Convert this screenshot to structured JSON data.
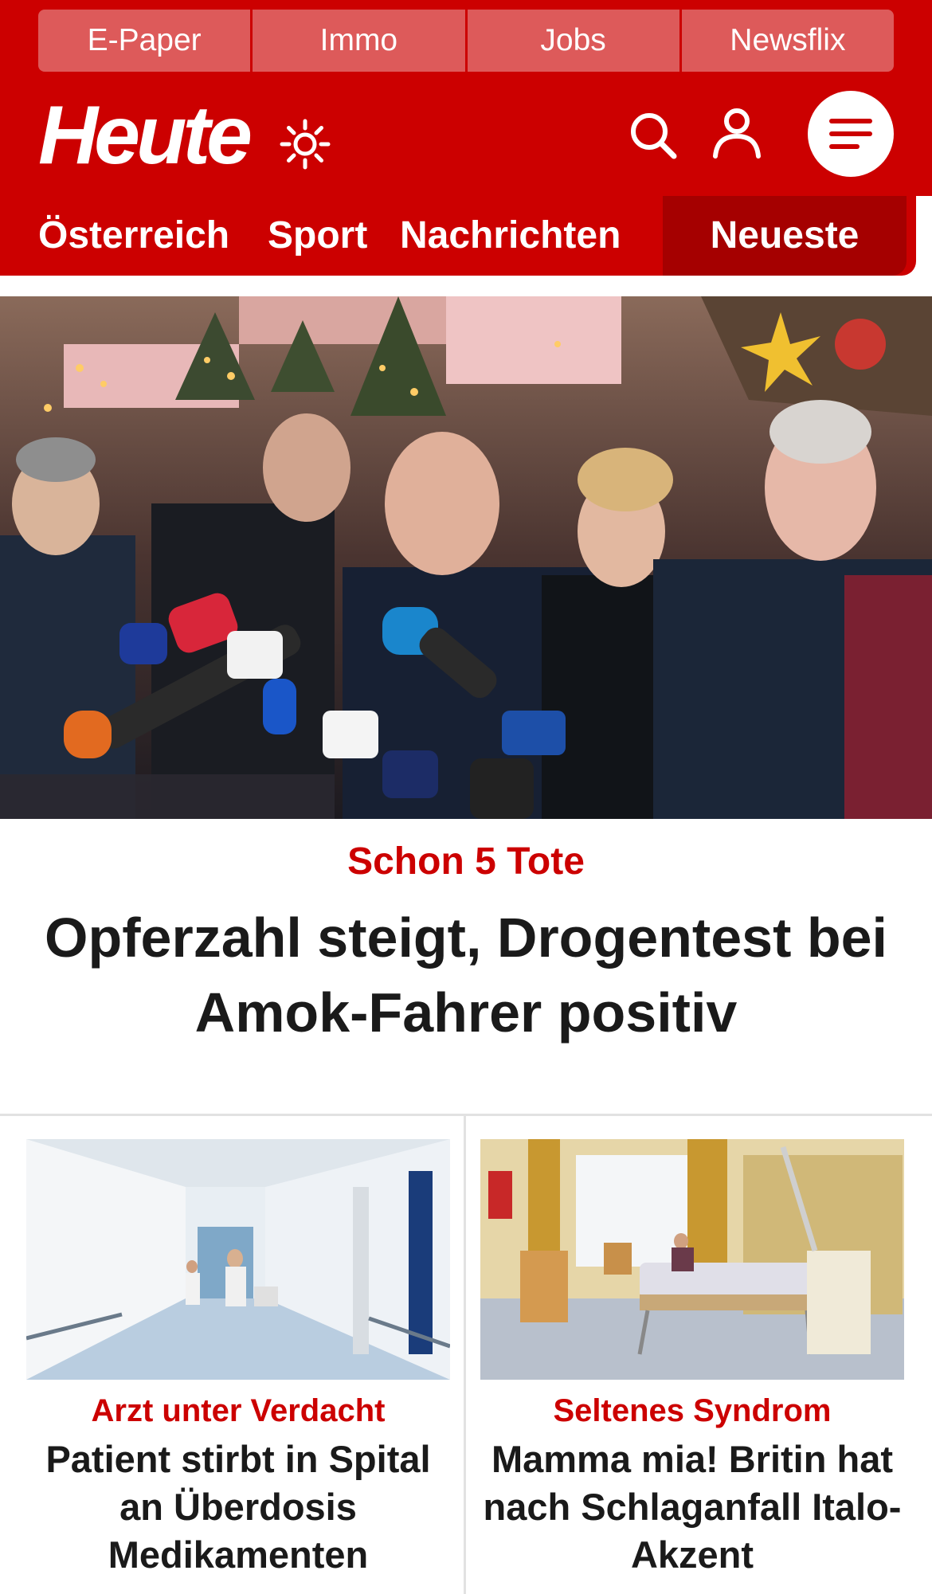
{
  "top_links": [
    "E-Paper",
    "Immo",
    "Jobs",
    "Newsflix"
  ],
  "brand": {
    "logo_text": "Heute",
    "brand_color": "#cc0000"
  },
  "header_icons": [
    "sun-icon",
    "search-icon",
    "user-icon",
    "menu-icon"
  ],
  "nav": {
    "items": [
      "Österreich",
      "Sport",
      "Nachrichten"
    ],
    "active_item": "Neueste"
  },
  "hero": {
    "kicker": "Schon 5 Tote",
    "title": "Opferzahl steigt, Drogentest bei Amok-Fahrer positiv"
  },
  "teasers": [
    {
      "kicker": "Arzt unter Verdacht",
      "title": "Patient stirbt in Spital an Überdosis Medikamenten"
    },
    {
      "kicker": "Seltenes Syndrom",
      "title": "Mamma mia! Britin hat nach Schlaganfall Italo-Akzent"
    }
  ]
}
